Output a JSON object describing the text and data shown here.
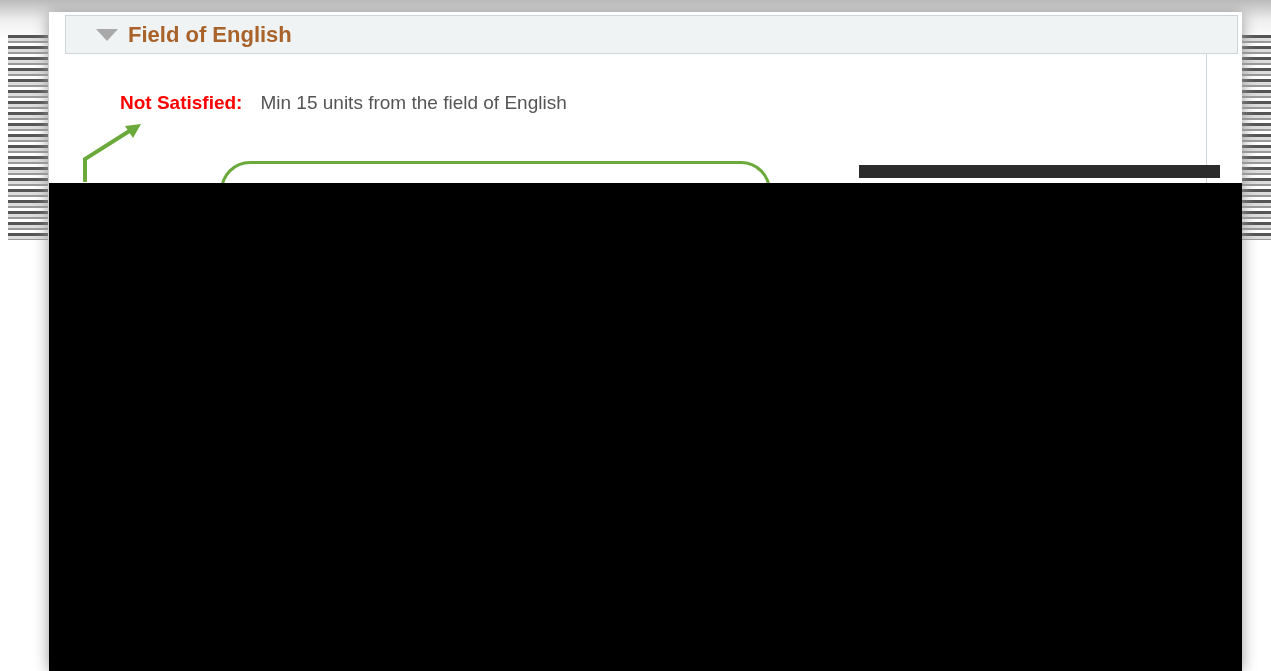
{
  "section": {
    "title": "Field of English",
    "expanded": true
  },
  "requirement": {
    "status": "Not Satisfied:",
    "satisfied": false,
    "description": "Min 15 units from the field of English"
  }
}
